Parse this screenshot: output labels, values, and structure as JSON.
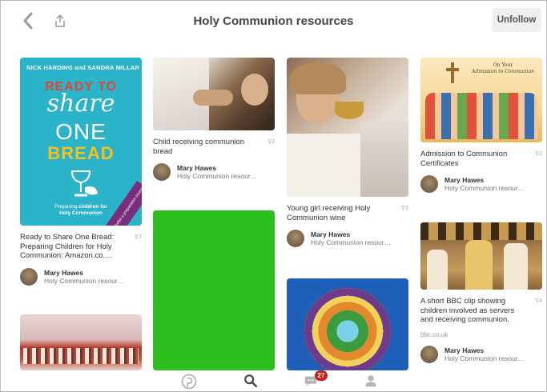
{
  "header": {
    "title": "Holy Communion resources",
    "unfollow_label": "Unfollow"
  },
  "book_cover": {
    "authors": "NICK HARDING and SANDRA MILLAR",
    "line1": "READY TO",
    "line2": "share",
    "line3": "ONE",
    "line4": "BREAD",
    "subtitle_a": "Preparing",
    "subtitle_b": "children for",
    "subtitle_c": "Holy Communion",
    "corner_text": "includes a preparation course"
  },
  "certificate_image": {
    "heading_a": "On Your",
    "heading_b": "Admission to Communion"
  },
  "pins": [
    {
      "description": "Ready to Share One Bread: Preparing Children for Holy Communion: Amazon.co.…",
      "repins": "1",
      "pinner": "Mary Hawes",
      "board": "Holy Communion resour…"
    },
    {
      "description": "Child receiving communion bread",
      "repins": "3",
      "pinner": "Mary Hawes",
      "board": "Holy Communion resour…"
    },
    {
      "description": "Young girl receiving Holy Communion wine",
      "repins": "3",
      "pinner": "Mary Hawes",
      "board": "Holy Communion resour…"
    },
    {
      "description": "Admission to Communion Certificates",
      "repins": "2",
      "pinner": "Mary Hawes",
      "board": "Holy Communion resour…"
    },
    {
      "description": "A short BBC clip showing children involved as servers and receiving communion.",
      "repins": "4",
      "source": "bbc.co.uk",
      "pinner": "Mary Hawes",
      "board": "Holy Communion resour…"
    }
  ],
  "nav": {
    "notification_count": "27",
    "icons": [
      "pinterest-icon",
      "search-icon",
      "messages-icon",
      "profile-icon"
    ]
  },
  "colors": {
    "green_placeholder": "#2dbf1e",
    "book_teal": "#2ab3c9",
    "book_red": "#e4442f",
    "book_yellow": "#f4c21c",
    "badge_red": "#cc1f1f"
  }
}
